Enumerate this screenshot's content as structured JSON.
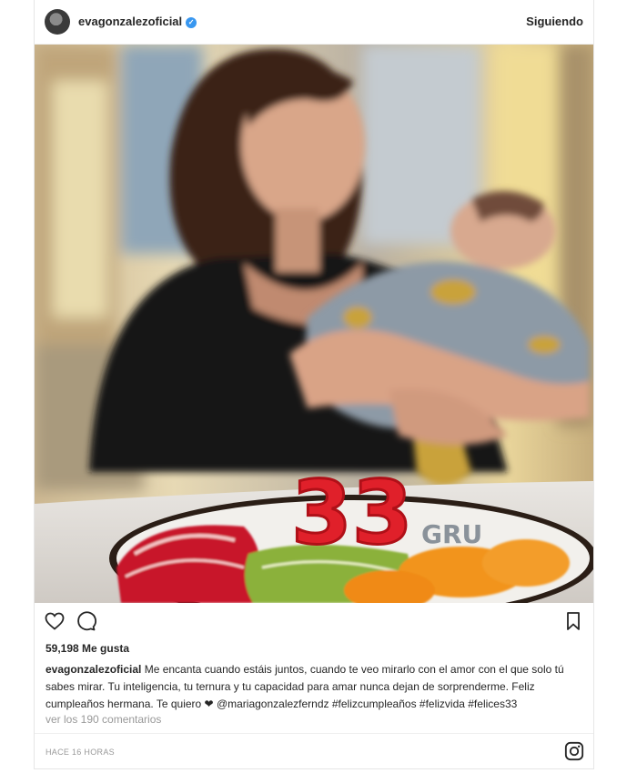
{
  "post": {
    "username": "evagonzalezoficial",
    "follow_label": "Siguiendo",
    "likes": "59,198 Me gusta",
    "caption_user": "evagonzalezoficial",
    "caption_text": " Me encanta cuando estáis juntos, cuando te veo mirarlo con el amor con el que solo tú sabes mirar. Tu inteligencia, tu ternura y tu capacidad para amar nunca dejan de sorprenderme. Feliz cumpleaños hermana. Te quiero ❤ @mariagonzalezferndz #felizcumpleaños #felizvida #felices33",
    "comments_link": "ver los 190 comentarios",
    "timestamp": "HACE 16 HORAS",
    "photo_candle_text": "33"
  },
  "icons": {
    "avatar": "profile-avatar",
    "verified": "verified-badge-icon",
    "like": "heart-icon",
    "comment": "comment-bubble-icon",
    "save": "bookmark-icon",
    "brand": "instagram-logo-icon"
  },
  "colors": {
    "verified_blue": "#3897f0",
    "text": "#262626",
    "muted": "#999999",
    "candle_red": "#e0202a"
  }
}
